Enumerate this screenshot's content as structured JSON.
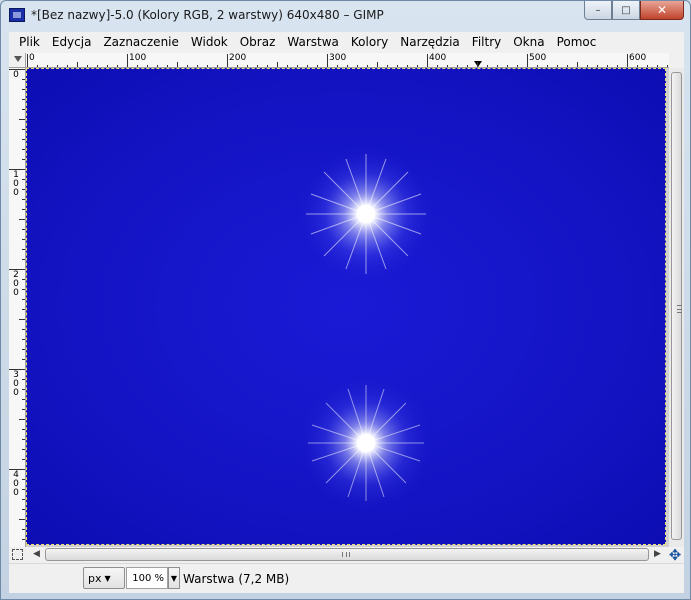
{
  "window": {
    "title": "*[Bez nazwy]-5.0 (Kolory RGB, 2 warstwy) 640x480 – GIMP",
    "minimize_label": "–",
    "maximize_label": "□",
    "close_label": "✕"
  },
  "menu": {
    "items": [
      {
        "label": "Plik"
      },
      {
        "label": "Edycja"
      },
      {
        "label": "Zaznaczenie"
      },
      {
        "label": "Widok"
      },
      {
        "label": "Obraz"
      },
      {
        "label": "Warstwa"
      },
      {
        "label": "Kolory"
      },
      {
        "label": "Narzędzia"
      },
      {
        "label": "Filtry"
      },
      {
        "label": "Okna"
      },
      {
        "label": "Pomoc"
      }
    ]
  },
  "rulers": {
    "horizontal_labels": [
      "0",
      "100",
      "200",
      "300",
      "400",
      "500",
      "600"
    ],
    "vertical_labels": [
      "0",
      "100",
      "200",
      "300",
      "400"
    ]
  },
  "canvas": {
    "background_color": "#1414c4",
    "sparkle_color": "#ffffff"
  },
  "statusbar": {
    "unit": "px",
    "zoom": "100 %",
    "status_text": "Warstwa (7,2 MB)"
  },
  "icons": {
    "app": "gimp-image-icon",
    "navigate": "four-way-arrow-icon",
    "quick_mask": "dashed-square-icon"
  }
}
